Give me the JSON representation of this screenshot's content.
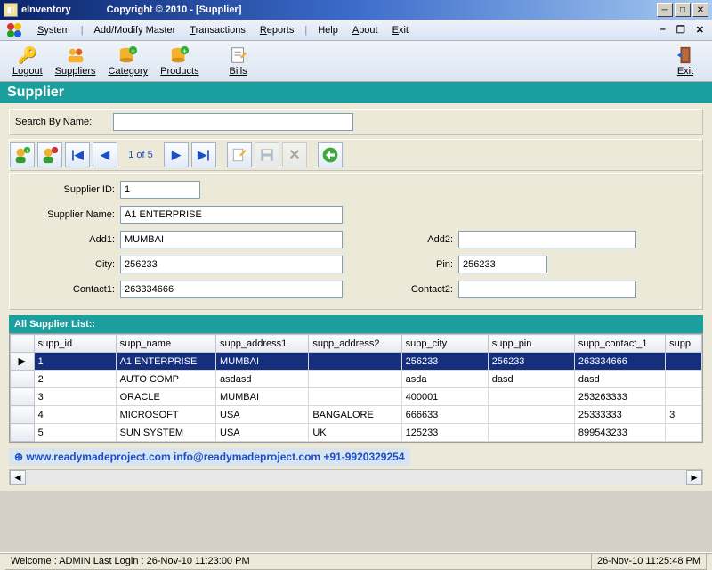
{
  "window": {
    "title": "eInventory",
    "copyright": "Copyright ©  2010 - [Supplier]"
  },
  "menu": {
    "system": "System",
    "addmodify": "Add/Modify Master",
    "transactions": "Transactions",
    "reports": "Reports",
    "help": "Help",
    "about": "About",
    "exit": "Exit"
  },
  "toolbar": {
    "logout": "Logout",
    "suppliers": "Suppliers",
    "category": "Category",
    "products": "Products",
    "bills": "Bills",
    "exit": "Exit"
  },
  "page": {
    "title": "Supplier"
  },
  "search": {
    "label": "Search By Name:",
    "value": ""
  },
  "nav": {
    "counter": "1 of 5"
  },
  "form": {
    "labels": {
      "supplier_id": "Supplier ID:",
      "supplier_name": "Supplier Name:",
      "add1": "Add1:",
      "add2": "Add2:",
      "city": "City:",
      "pin": "Pin:",
      "contact1": "Contact1:",
      "contact2": "Contact2:"
    },
    "values": {
      "supplier_id": "1",
      "supplier_name": "A1 ENTERPRISE",
      "add1": "MUMBAI",
      "add2": "",
      "city": "256233",
      "pin": "256233",
      "contact1": "263334666",
      "contact2": ""
    }
  },
  "grid": {
    "title": "All Supplier List::",
    "columns": [
      "supp_id",
      "supp_name",
      "supp_address1",
      "supp_address2",
      "supp_city",
      "supp_pin",
      "supp_contact_1",
      "supp"
    ],
    "rows": [
      {
        "selected": true,
        "cells": [
          "1",
          "A1 ENTERPRISE",
          "MUMBAI",
          "",
          "256233",
          "256233",
          "263334666",
          ""
        ]
      },
      {
        "selected": false,
        "cells": [
          "2",
          "AUTO COMP",
          "asdasd",
          "",
          "asda",
          "dasd",
          "dasd",
          ""
        ]
      },
      {
        "selected": false,
        "cells": [
          "3",
          "ORACLE",
          "MUMBAI",
          "",
          "400001",
          "",
          "253263333",
          ""
        ]
      },
      {
        "selected": false,
        "cells": [
          "4",
          "MICROSOFT",
          "USA",
          "BANGALORE",
          "666633",
          "",
          "25333333",
          "3"
        ]
      },
      {
        "selected": false,
        "cells": [
          "5",
          "SUN SYSTEM",
          "USA",
          "UK",
          "125233",
          "",
          "899543233",
          ""
        ]
      }
    ]
  },
  "watermark": "⊕ www.readymadeproject.com  info@readymadeproject.com  +91-9920329254",
  "status": {
    "left": "Welcome : ADMIN  Last Login : 26-Nov-10 11:23:00 PM",
    "right": "26-Nov-10 11:25:48 PM"
  }
}
